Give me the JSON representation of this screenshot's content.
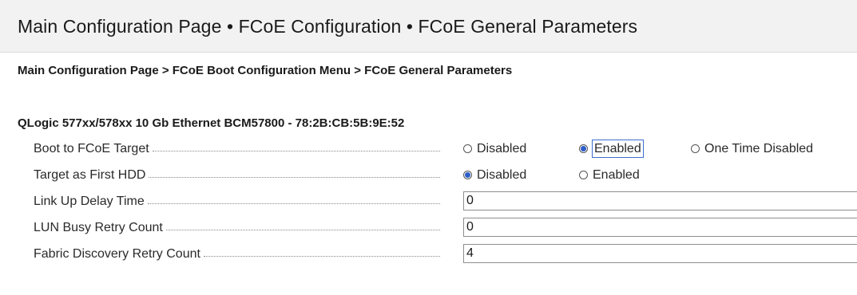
{
  "header": {
    "title": "Main Configuration Page • FCoE Configuration • FCoE General Parameters"
  },
  "breadcrumb": "Main Configuration Page > FCoE Boot Configuration Menu > FCoE General Parameters",
  "device": {
    "title": "QLogic 577xx/578xx 10 Gb Ethernet BCM57800 - 78:2B:CB:5B:9E:52"
  },
  "settings": [
    {
      "label": "Boot to FCoE Target",
      "type": "radio",
      "options": [
        "Disabled",
        "Enabled",
        "One Time Disabled"
      ],
      "selected": "Enabled"
    },
    {
      "label": "Target as First HDD",
      "type": "radio",
      "options": [
        "Disabled",
        "Enabled"
      ],
      "selected": "Disabled"
    },
    {
      "label": "Link Up Delay Time",
      "type": "text",
      "value": "0"
    },
    {
      "label": "LUN Busy Retry Count",
      "type": "text",
      "value": "0"
    },
    {
      "label": "Fabric Discovery Retry Count",
      "type": "text",
      "value": "4"
    }
  ],
  "colors": {
    "header_background": "#f2f2f2",
    "radio_selected": "#2d5ec9",
    "focus_outline": "#3c6ecf"
  }
}
